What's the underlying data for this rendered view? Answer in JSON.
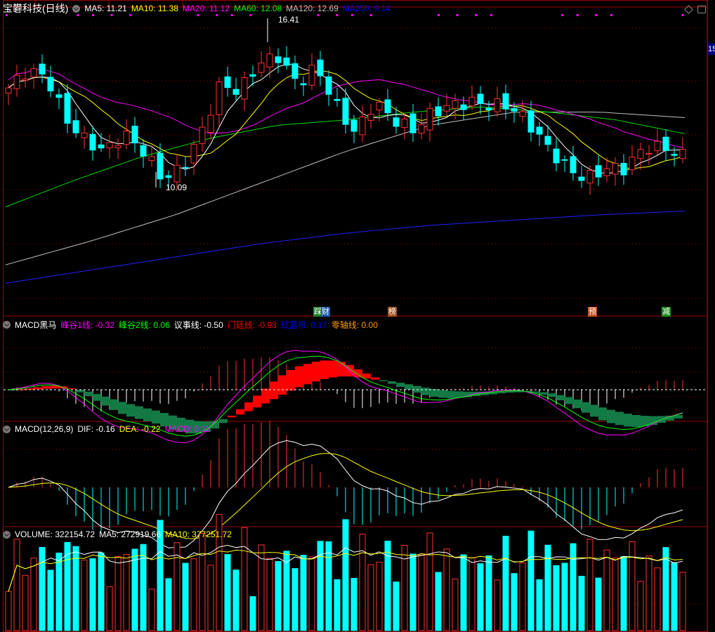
{
  "main": {
    "title": "宝礬科技(日线)",
    "ma": [
      {
        "label": "MA5: 11.21",
        "color": "#ffffff"
      },
      {
        "label": "MA10: 11.38",
        "color": "#ffff00"
      },
      {
        "label": "MA20: 11.12",
        "color": "#ff00ff"
      },
      {
        "label": "MA60: 12.08",
        "color": "#00ff00"
      },
      {
        "label": "MA120: 12.69",
        "color": "#c0c0c0"
      },
      {
        "label": "MA250: 9.14",
        "color": "#0000ff"
      }
    ],
    "high_label": "16.41",
    "low_label": "10.09",
    "axis_price": "15",
    "tags": [
      {
        "text": "财",
        "color": "#1e5aa0"
      },
      {
        "text": "榜",
        "color": "#a0501e"
      },
      {
        "text": "预",
        "color": "#c8501e"
      },
      {
        "text": "减",
        "color": "#1e8c1e"
      }
    ]
  },
  "heima": {
    "title": "MACD黑马",
    "items": [
      {
        "label": "峰谷1线: -0.32",
        "color": "#ff00ff"
      },
      {
        "label": "峰谷2线: 0.06",
        "color": "#00ff00"
      },
      {
        "label": "议事线: -0.50",
        "color": "#ffffff"
      },
      {
        "label": "门廷线: -0.93",
        "color": "#ff0000"
      },
      {
        "label": "红蓝带: 0.17",
        "color": "#0000ff"
      },
      {
        "label": "零轴线: 0.00",
        "color": "#ff9900"
      }
    ]
  },
  "macd": {
    "title": "MACD(12,26,9)",
    "items": [
      {
        "label": "DIF: -0.16",
        "color": "#ffffff"
      },
      {
        "label": "DEA: -0.22",
        "color": "#ffff00"
      },
      {
        "label": "MACD: 0.11",
        "color": "#ff00ff"
      }
    ]
  },
  "volume": {
    "items": [
      {
        "label": "VOLUME: 322154.72",
        "color": "#ffffff"
      },
      {
        "label": "MA5: 272919.66",
        "color": "#ffffff"
      },
      {
        "label": "MA10: 377251.72",
        "color": "#ffff00"
      }
    ]
  },
  "chart_data": {
    "type": "candlestick",
    "ylim": [
      6,
      17
    ],
    "close_path": [
      13.82,
      14.49,
      14.22,
      12.62,
      11.82,
      11.42,
      12.09,
      11.42,
      10.36,
      10.76,
      12.09,
      13.96,
      13.69,
      14.76,
      15.02,
      13.96,
      14.62,
      13.16,
      12.09,
      13.29,
      12.62,
      12.22,
      12.89,
      13.16,
      13.29,
      13.16,
      13.16,
      12.49,
      11.56,
      10.76,
      10.36,
      10.76,
      10.76,
      11.56,
      11.56,
      11.24
    ],
    "ma120_path": [
      7.1,
      8.0,
      9.0,
      10.2,
      11.4,
      12.4,
      12.9,
      12.9,
      12.69
    ],
    "ma250_path": [
      6.4,
      6.9,
      7.4,
      7.9,
      8.3,
      8.6,
      8.8,
      9.0,
      9.14
    ],
    "high": 16.41,
    "low": 10.09
  }
}
